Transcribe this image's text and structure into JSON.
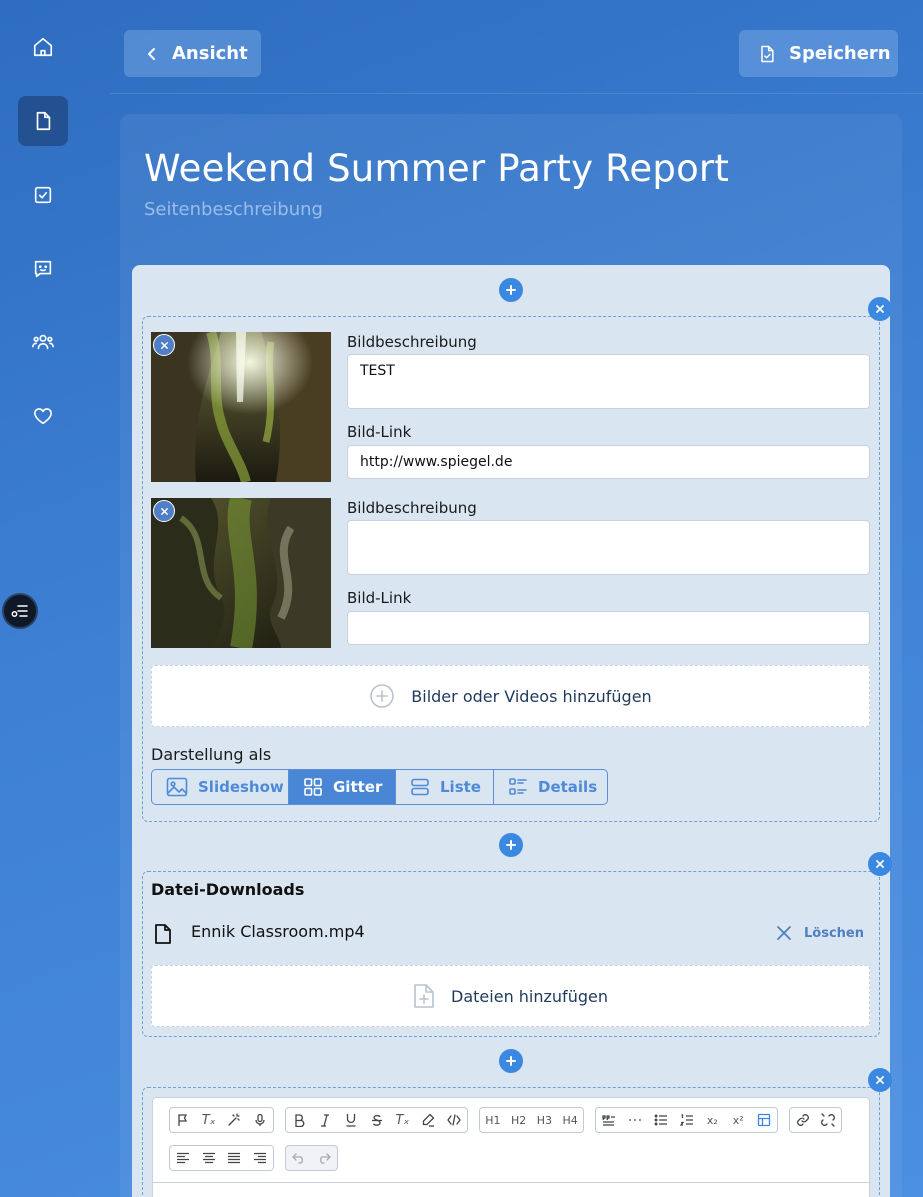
{
  "header": {
    "back_label": "Ansicht",
    "save_label": "Speichern"
  },
  "page": {
    "title": "Weekend Summer Party Report",
    "description_placeholder": "Seitenbeschreibung"
  },
  "gallery": {
    "images": [
      {
        "description_label": "Bildbeschreibung",
        "description_value": "TEST",
        "link_label": "Bild-Link",
        "link_value": "http://www.spiegel.de"
      },
      {
        "description_label": "Bildbeschreibung",
        "description_value": "",
        "link_label": "Bild-Link",
        "link_value": ""
      }
    ],
    "add_label": "Bilder oder Videos hinzufügen",
    "display_label": "Darstellung als",
    "display_options": [
      "Slideshow",
      "Gitter",
      "Liste",
      "Details"
    ],
    "display_selected": "Gitter"
  },
  "downloads": {
    "title": "Datei-Downloads",
    "files": [
      {
        "name": "Ennik Classroom.mp4",
        "delete_label": "Löschen"
      }
    ],
    "add_label": "Dateien hinzufügen"
  },
  "toolbar": {
    "heading_buttons": [
      "H1",
      "H2",
      "H3",
      "H4"
    ],
    "sub_label": "x₂",
    "sup_label": "x²",
    "clear_format_label": "Tₓ"
  },
  "colors": {
    "accent": "#3b88e0",
    "editor_bg": "#dae5f2",
    "segment_active": "#4a86d6"
  }
}
